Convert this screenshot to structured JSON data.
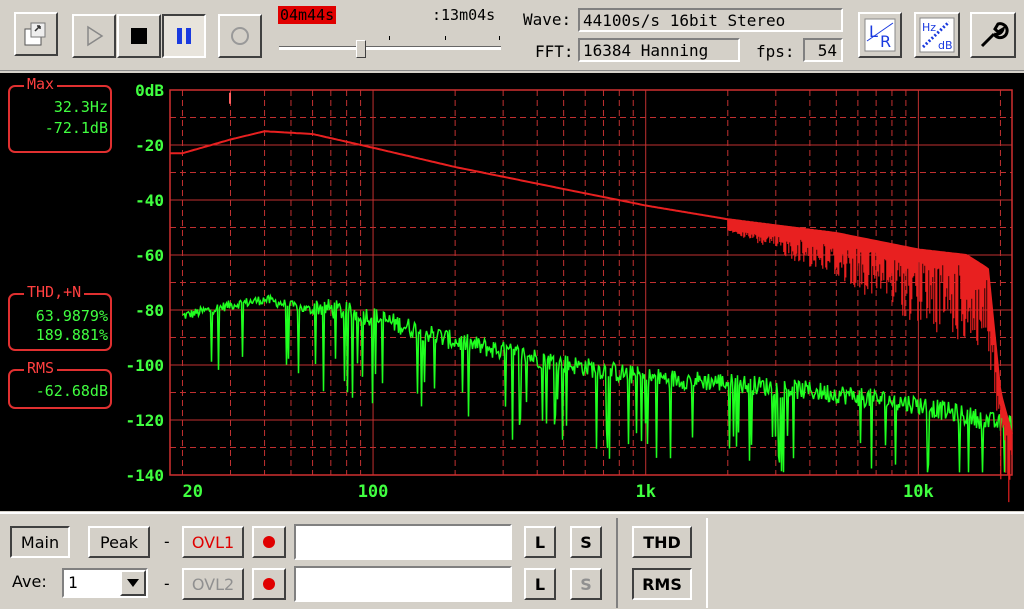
{
  "toolbar": {
    "elapsed": "04m44s",
    "total": ":13m04s",
    "wave_label": "Wave:",
    "wave_value": "44100s/s 16bit Stereo",
    "fft_label": "FFT:",
    "fft_value": "16384 Hanning",
    "fps_label": "fps:",
    "fps_value": "54",
    "progress_fraction": 0.36,
    "lr_label": "LR",
    "hzdb_label_hz": "Hz",
    "hzdb_label_db": "dB"
  },
  "panels": {
    "max_title": "Max",
    "max_freq": "32.3Hz",
    "max_level": "-72.1dB",
    "thd_title": "THD,+N",
    "thd_val1": "63.9879%",
    "thd_val2": "189.881%",
    "rms_title": "RMS",
    "rms_val": "-62.68dB"
  },
  "chart_data": {
    "type": "line",
    "x_scale": "log",
    "xlim": [
      18,
      22050
    ],
    "ylim": [
      -140,
      0
    ],
    "yticks": [
      "0dB",
      "-20",
      "-40",
      "-60",
      "-80",
      "-100",
      "-120",
      "-140"
    ],
    "xticks": [
      "20",
      "100",
      "1k",
      "10k"
    ],
    "grid": true,
    "series": [
      {
        "name": "",
        "color": "#e82020",
        "x": [
          20,
          30,
          40,
          60,
          100,
          200,
          500,
          1000,
          2000,
          5000,
          10000,
          15000,
          18000,
          20000,
          22000
        ],
        "y": [
          -23,
          -18,
          -15,
          -16,
          -21,
          -28,
          -36,
          -42,
          -47,
          -52,
          -58,
          -60,
          -65,
          -110,
          -125
        ]
      },
      {
        "name": "",
        "color": "#20ff20",
        "x": [
          20,
          30,
          40,
          60,
          100,
          200,
          500,
          1000,
          2000,
          5000,
          10000,
          20000
        ],
        "y": [
          -84,
          -80,
          -78,
          -82,
          -86,
          -95,
          -103,
          -108,
          -110,
          -114,
          -118,
          -125
        ]
      }
    ]
  },
  "bottom": {
    "main_label": "Main",
    "peak_label": "Peak",
    "dash1": "-",
    "dash2": "-",
    "ovl1_label": "OVL1",
    "ovl2_label": "OVL2",
    "l_label": "L",
    "s_label": "S",
    "thd_label": "THD",
    "rms_label": "RMS",
    "ave_label": "Ave:",
    "ave_value": "1"
  }
}
